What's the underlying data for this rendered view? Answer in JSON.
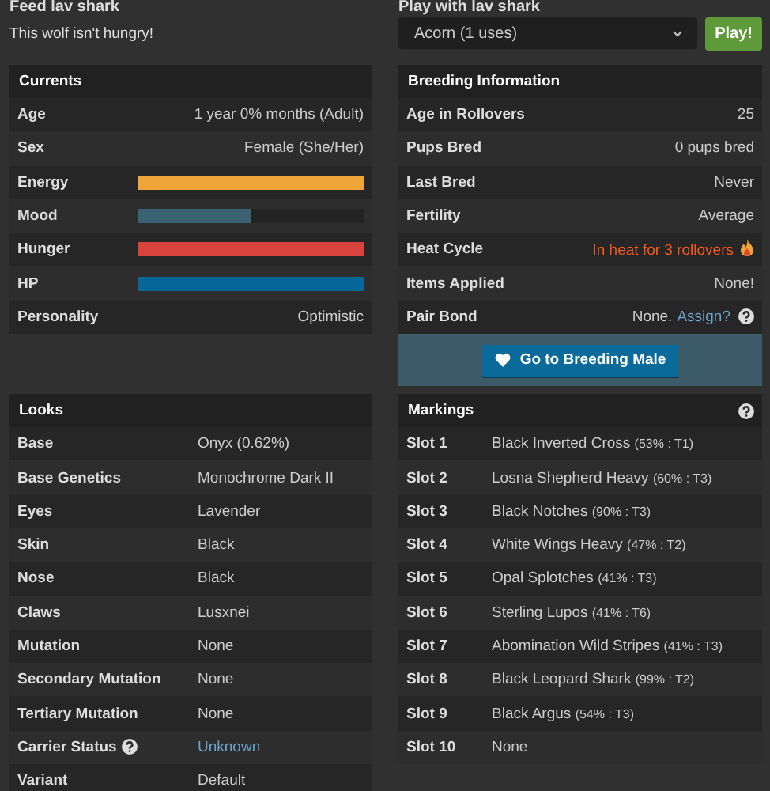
{
  "feed": {
    "heading": "Feed lav shark",
    "message": "This wolf isn't hungry!"
  },
  "play": {
    "heading": "Play with lav shark",
    "item": "Acorn (1 uses)",
    "button": "Play!"
  },
  "currents": {
    "title": "Currents",
    "rows": [
      {
        "kind": "text",
        "label": "Age",
        "value": "1 year 0% months (Adult)"
      },
      {
        "kind": "text",
        "label": "Sex",
        "value": "Female (She/Her)"
      },
      {
        "kind": "bar",
        "label": "Energy",
        "level": 1.0,
        "color": "#f0a53a"
      },
      {
        "kind": "bar",
        "label": "Mood",
        "level": 0.5,
        "color": "#3b6273"
      },
      {
        "kind": "bar",
        "label": "Hunger",
        "level": 1.0,
        "color": "#d9433d"
      },
      {
        "kind": "bar",
        "label": "HP",
        "level": 1.0,
        "color": "#07679a"
      },
      {
        "kind": "text",
        "label": "Personality",
        "value": "Optimistic"
      }
    ]
  },
  "breeding": {
    "title": "Breeding Information",
    "rows": [
      {
        "kind": "text",
        "label": "Age in Rollovers",
        "value": "25"
      },
      {
        "kind": "text",
        "label": "Pups Bred",
        "value": "0 pups bred"
      },
      {
        "kind": "text",
        "label": "Last Bred",
        "value": "Never"
      },
      {
        "kind": "text",
        "label": "Fertility",
        "value": "Average"
      },
      {
        "kind": "alert",
        "label": "Heat Cycle",
        "value": "In heat for 3 rollovers"
      },
      {
        "kind": "text",
        "label": "Items Applied",
        "value": "None!"
      },
      {
        "kind": "bond",
        "label": "Pair Bond",
        "value": "None.",
        "link": "Assign?"
      }
    ],
    "button": "Go to Breeding Male"
  },
  "looks": {
    "title": "Looks",
    "rows": [
      {
        "kind": "text",
        "label": "Base",
        "value": "Onyx (0.62%)"
      },
      {
        "kind": "text",
        "label": "Base Genetics",
        "value": "Monochrome Dark II"
      },
      {
        "kind": "text",
        "label": "Eyes",
        "value": "Lavender"
      },
      {
        "kind": "text",
        "label": "Skin",
        "value": "Black"
      },
      {
        "kind": "text",
        "label": "Nose",
        "value": "Black"
      },
      {
        "kind": "text",
        "label": "Claws",
        "value": "Lusxnei"
      },
      {
        "kind": "text",
        "label": "Mutation",
        "value": "None"
      },
      {
        "kind": "text",
        "label": "Secondary Mutation",
        "value": "None"
      },
      {
        "kind": "text",
        "label": "Tertiary Mutation",
        "value": "None"
      },
      {
        "kind": "link",
        "label": "Carrier Status",
        "value": "Unknown"
      },
      {
        "kind": "text",
        "label": "Variant",
        "value": "Default"
      }
    ]
  },
  "markings": {
    "title": "Markings",
    "rows": [
      {
        "label": "Slot 1",
        "name": "Black Inverted Cross",
        "detail": "(53% : T1)"
      },
      {
        "label": "Slot 2",
        "name": "Losna Shepherd Heavy",
        "detail": "(60% : T3)"
      },
      {
        "label": "Slot 3",
        "name": "Black Notches",
        "detail": "(90% : T3)"
      },
      {
        "label": "Slot 4",
        "name": "White Wings Heavy",
        "detail": "(47% : T2)"
      },
      {
        "label": "Slot 5",
        "name": "Opal Splotches",
        "detail": "(41% : T3)"
      },
      {
        "label": "Slot 6",
        "name": "Sterling Lupos",
        "detail": "(41% : T6)"
      },
      {
        "label": "Slot 7",
        "name": "Abomination Wild Stripes",
        "detail": "(41% : T3)"
      },
      {
        "label": "Slot 8",
        "name": "Black Leopard Shark",
        "detail": "(99% : T2)"
      },
      {
        "label": "Slot 9",
        "name": "Black Argus",
        "detail": "(54% : T3)"
      },
      {
        "label": "Slot 10",
        "name": "None"
      }
    ]
  }
}
